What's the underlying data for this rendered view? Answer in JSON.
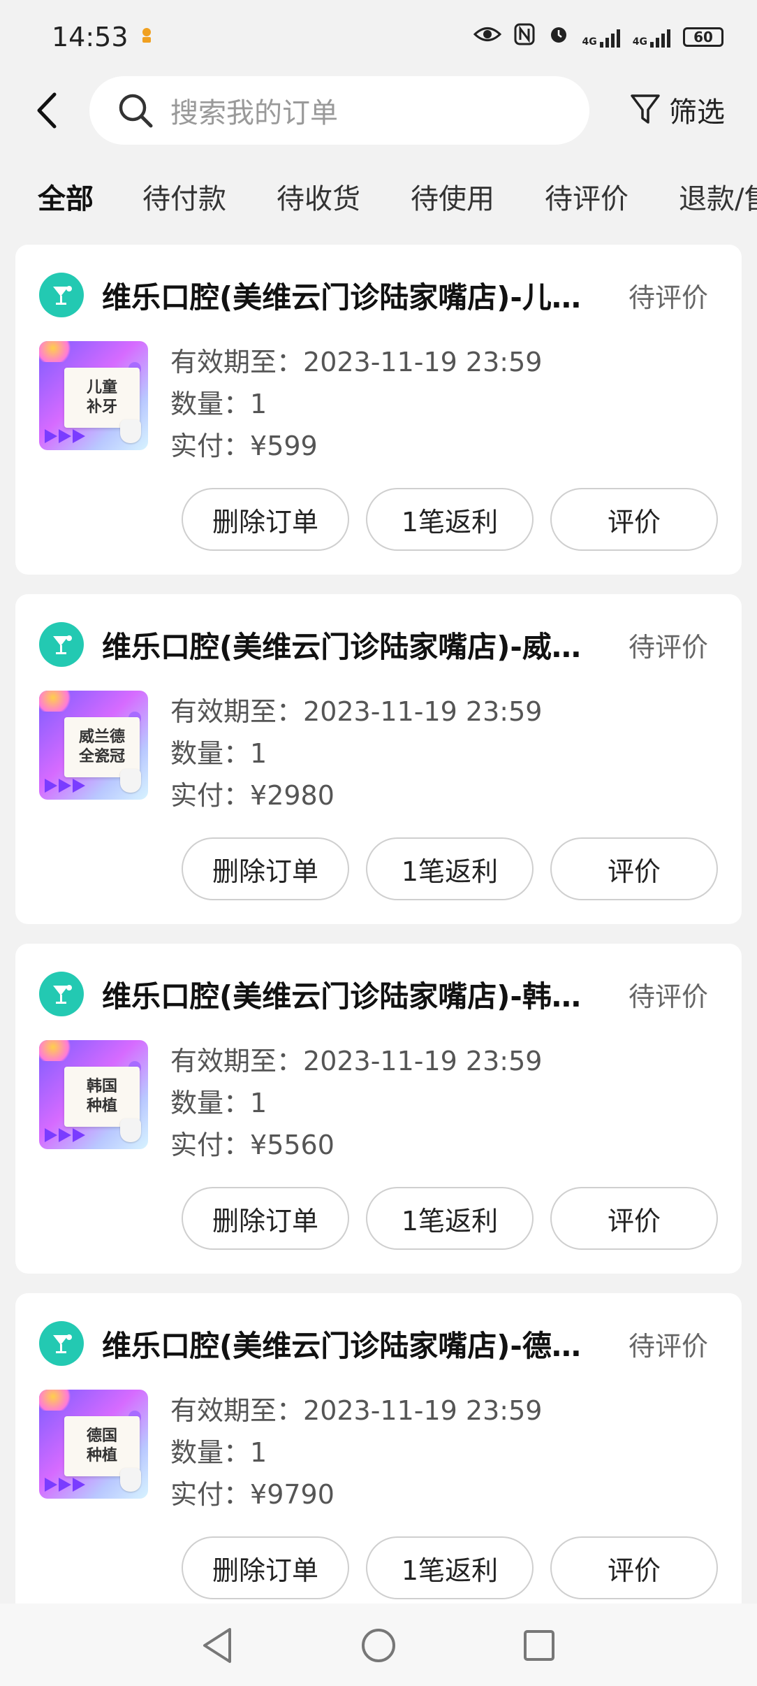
{
  "status_bar": {
    "time": "14:53",
    "battery": "60",
    "network1": "4G",
    "network2": "4G"
  },
  "header": {
    "search_placeholder": "搜索我的订单",
    "filter_label": "筛选"
  },
  "tabs": [
    {
      "label": "全部"
    },
    {
      "label": "待付款"
    },
    {
      "label": "待收货"
    },
    {
      "label": "待使用"
    },
    {
      "label": "待评价"
    },
    {
      "label": "退款/售后"
    }
  ],
  "orders": [
    {
      "store": "维乐口腔(美维云门诊陆家嘴店)-儿童补牙",
      "status": "待评价",
      "thumb_text": "儿童\n补牙",
      "expiry_label": "有效期至：",
      "expiry": "2023-11-19 23:59",
      "qty_label": "数量：",
      "qty": "1",
      "paid_label": "实付：",
      "paid": "¥599",
      "actions": [
        "删除订单",
        "1笔返利",
        "评价"
      ]
    },
    {
      "store": "维乐口腔(美维云门诊陆家嘴店)-威兰德全瓷冠",
      "status": "待评价",
      "thumb_text": "威兰德\n全瓷冠",
      "expiry_label": "有效期至：",
      "expiry": "2023-11-19 23:59",
      "qty_label": "数量：",
      "qty": "1",
      "paid_label": "实付：",
      "paid": "¥2980",
      "actions": [
        "删除订单",
        "1笔返利",
        "评价"
      ]
    },
    {
      "store": "维乐口腔(美维云门诊陆家嘴店)-韩国种植",
      "status": "待评价",
      "thumb_text": "韩国\n种植",
      "expiry_label": "有效期至：",
      "expiry": "2023-11-19 23:59",
      "qty_label": "数量：",
      "qty": "1",
      "paid_label": "实付：",
      "paid": "¥5560",
      "actions": [
        "删除订单",
        "1笔返利",
        "评价"
      ]
    },
    {
      "store": "维乐口腔(美维云门诊陆家嘴店)-德国种植",
      "status": "待评价",
      "thumb_text": "德国\n种植",
      "expiry_label": "有效期至：",
      "expiry": "2023-11-19 23:59",
      "qty_label": "数量：",
      "qty": "1",
      "paid_label": "实付：",
      "paid": "¥9790",
      "actions": [
        "删除订单",
        "1笔返利",
        "评价"
      ]
    }
  ],
  "colors": {
    "accent": "#f5c400",
    "store_icon": "#23c9b2",
    "background": "#f2f2f2"
  }
}
